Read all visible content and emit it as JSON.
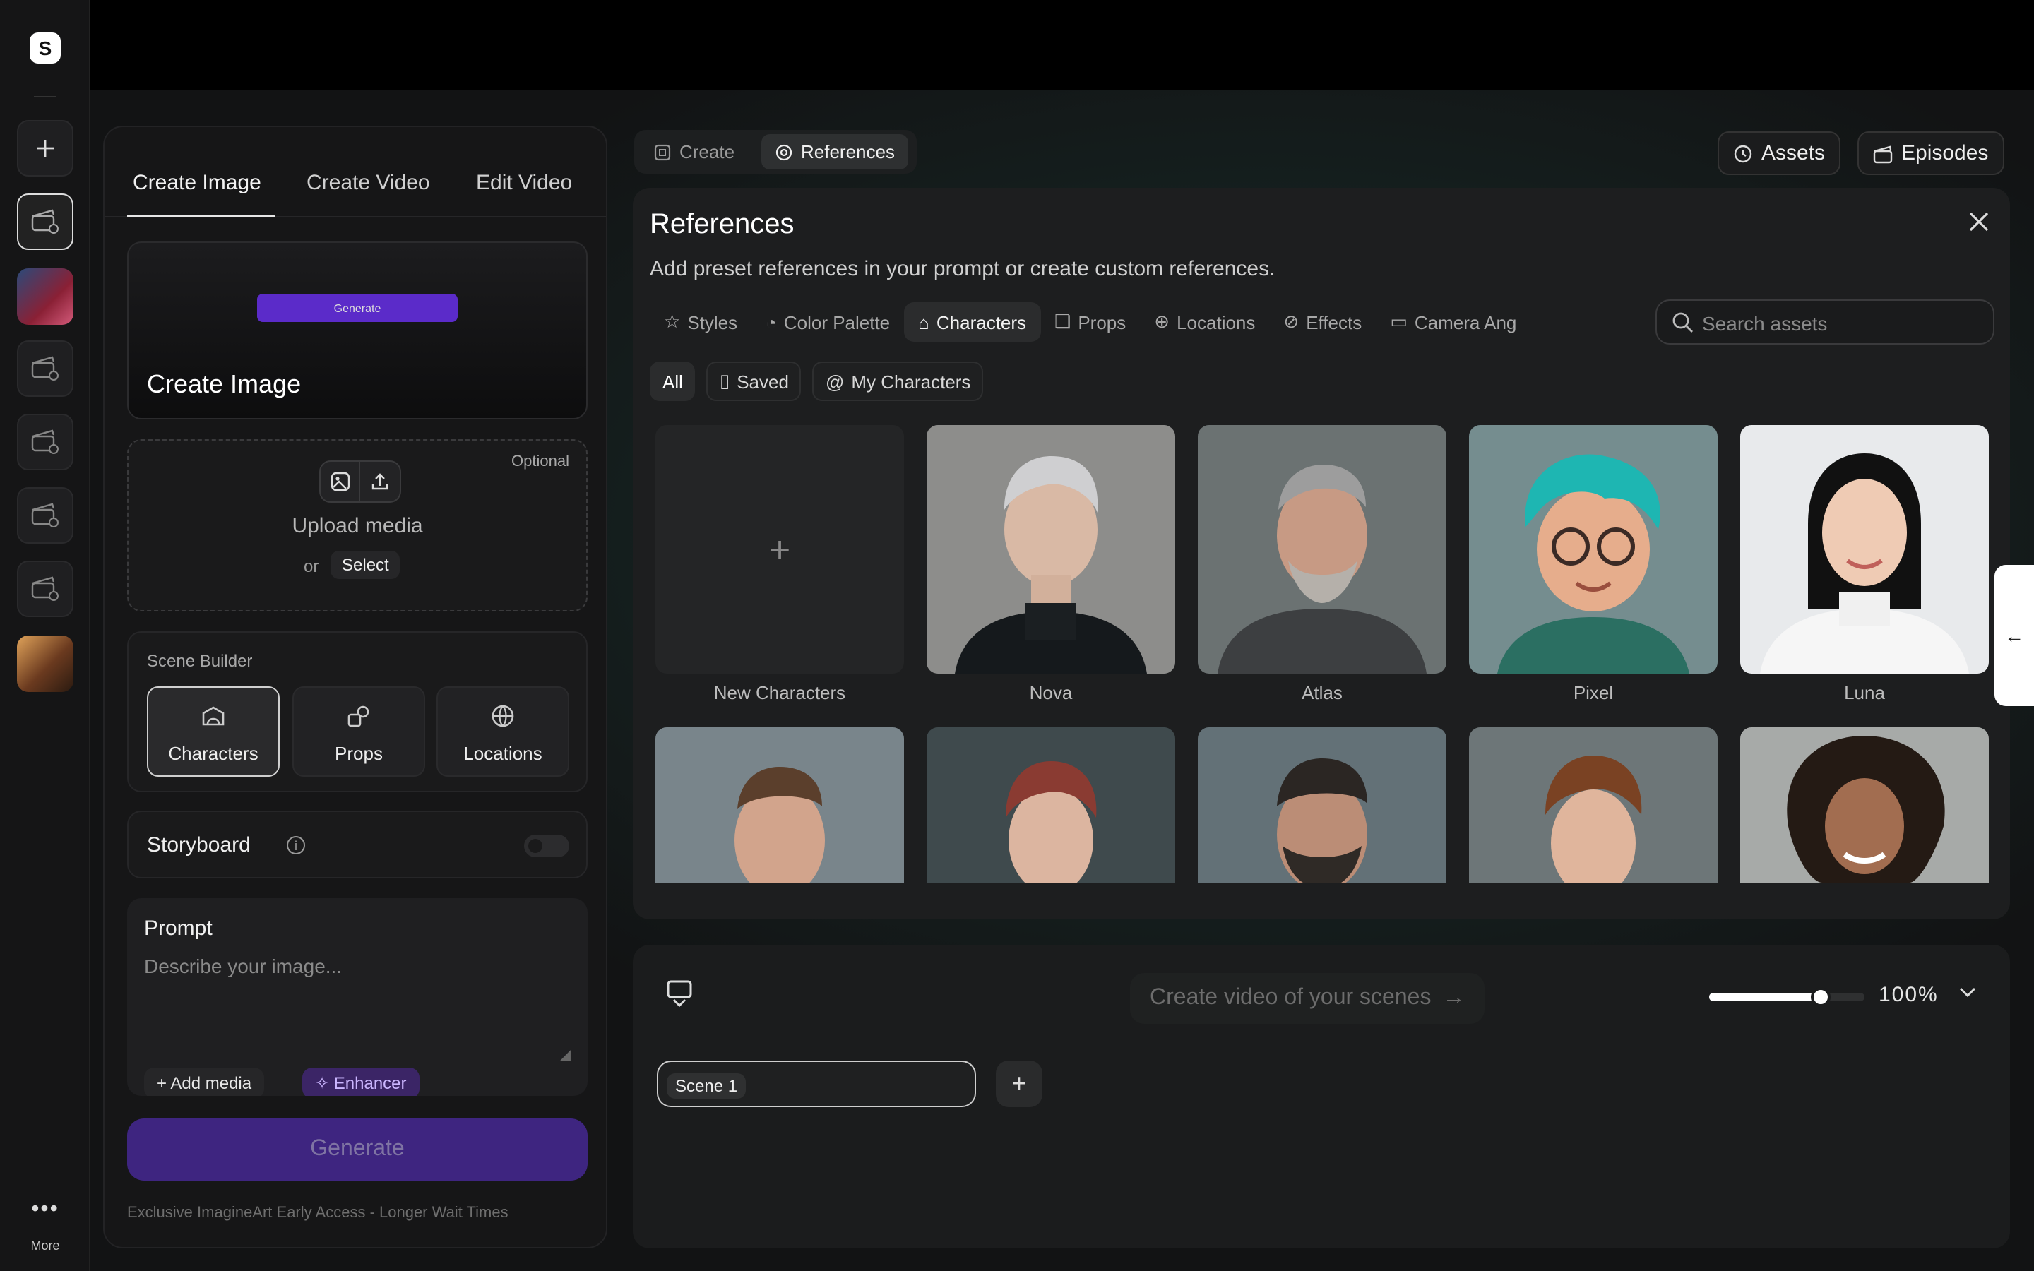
{
  "rail": {
    "logo": "S",
    "more_label": "More"
  },
  "left_panel": {
    "tabs": [
      "Create Image",
      "Create Video",
      "Edit Video"
    ],
    "hero": {
      "button_label": "Generate",
      "title": "Create Image"
    },
    "upload": {
      "optional": "Optional",
      "label": "Upload media",
      "or": "or",
      "select": "Select"
    },
    "scene_builder": {
      "label": "Scene Builder",
      "items": [
        "Characters",
        "Props",
        "Locations"
      ],
      "selected": "Characters"
    },
    "storyboard": {
      "label": "Storyboard",
      "enabled": false
    },
    "prompt": {
      "label": "Prompt",
      "placeholder": "Describe your image...",
      "add_media": "Add media",
      "enhancer": "Enhancer"
    },
    "generate_label": "Generate",
    "footnote": "Exclusive ImagineArt Early Access - Longer Wait Times"
  },
  "mode_tabs": {
    "create": "Create",
    "references": "References",
    "active": "References"
  },
  "top_right": {
    "assets": "Assets",
    "episodes": "Episodes"
  },
  "references": {
    "title": "References",
    "subtitle": "Add preset references in your prompt or create custom references.",
    "categories": [
      "Styles",
      "Color Palette",
      "Characters",
      "Props",
      "Locations",
      "Effects",
      "Camera Ang"
    ],
    "active_category": "Characters",
    "search_placeholder": "Search assets",
    "filters": [
      "All",
      "Saved",
      "My Characters"
    ],
    "active_filter": "All",
    "new_card_label": "New Characters",
    "characters": [
      "Nova",
      "Atlas",
      "Pixel",
      "Luna"
    ]
  },
  "timeline": {
    "create_video": "Create video of your scenes",
    "zoom": "100%",
    "zoom_fraction": 0.72,
    "scene_label": "Scene 1"
  }
}
